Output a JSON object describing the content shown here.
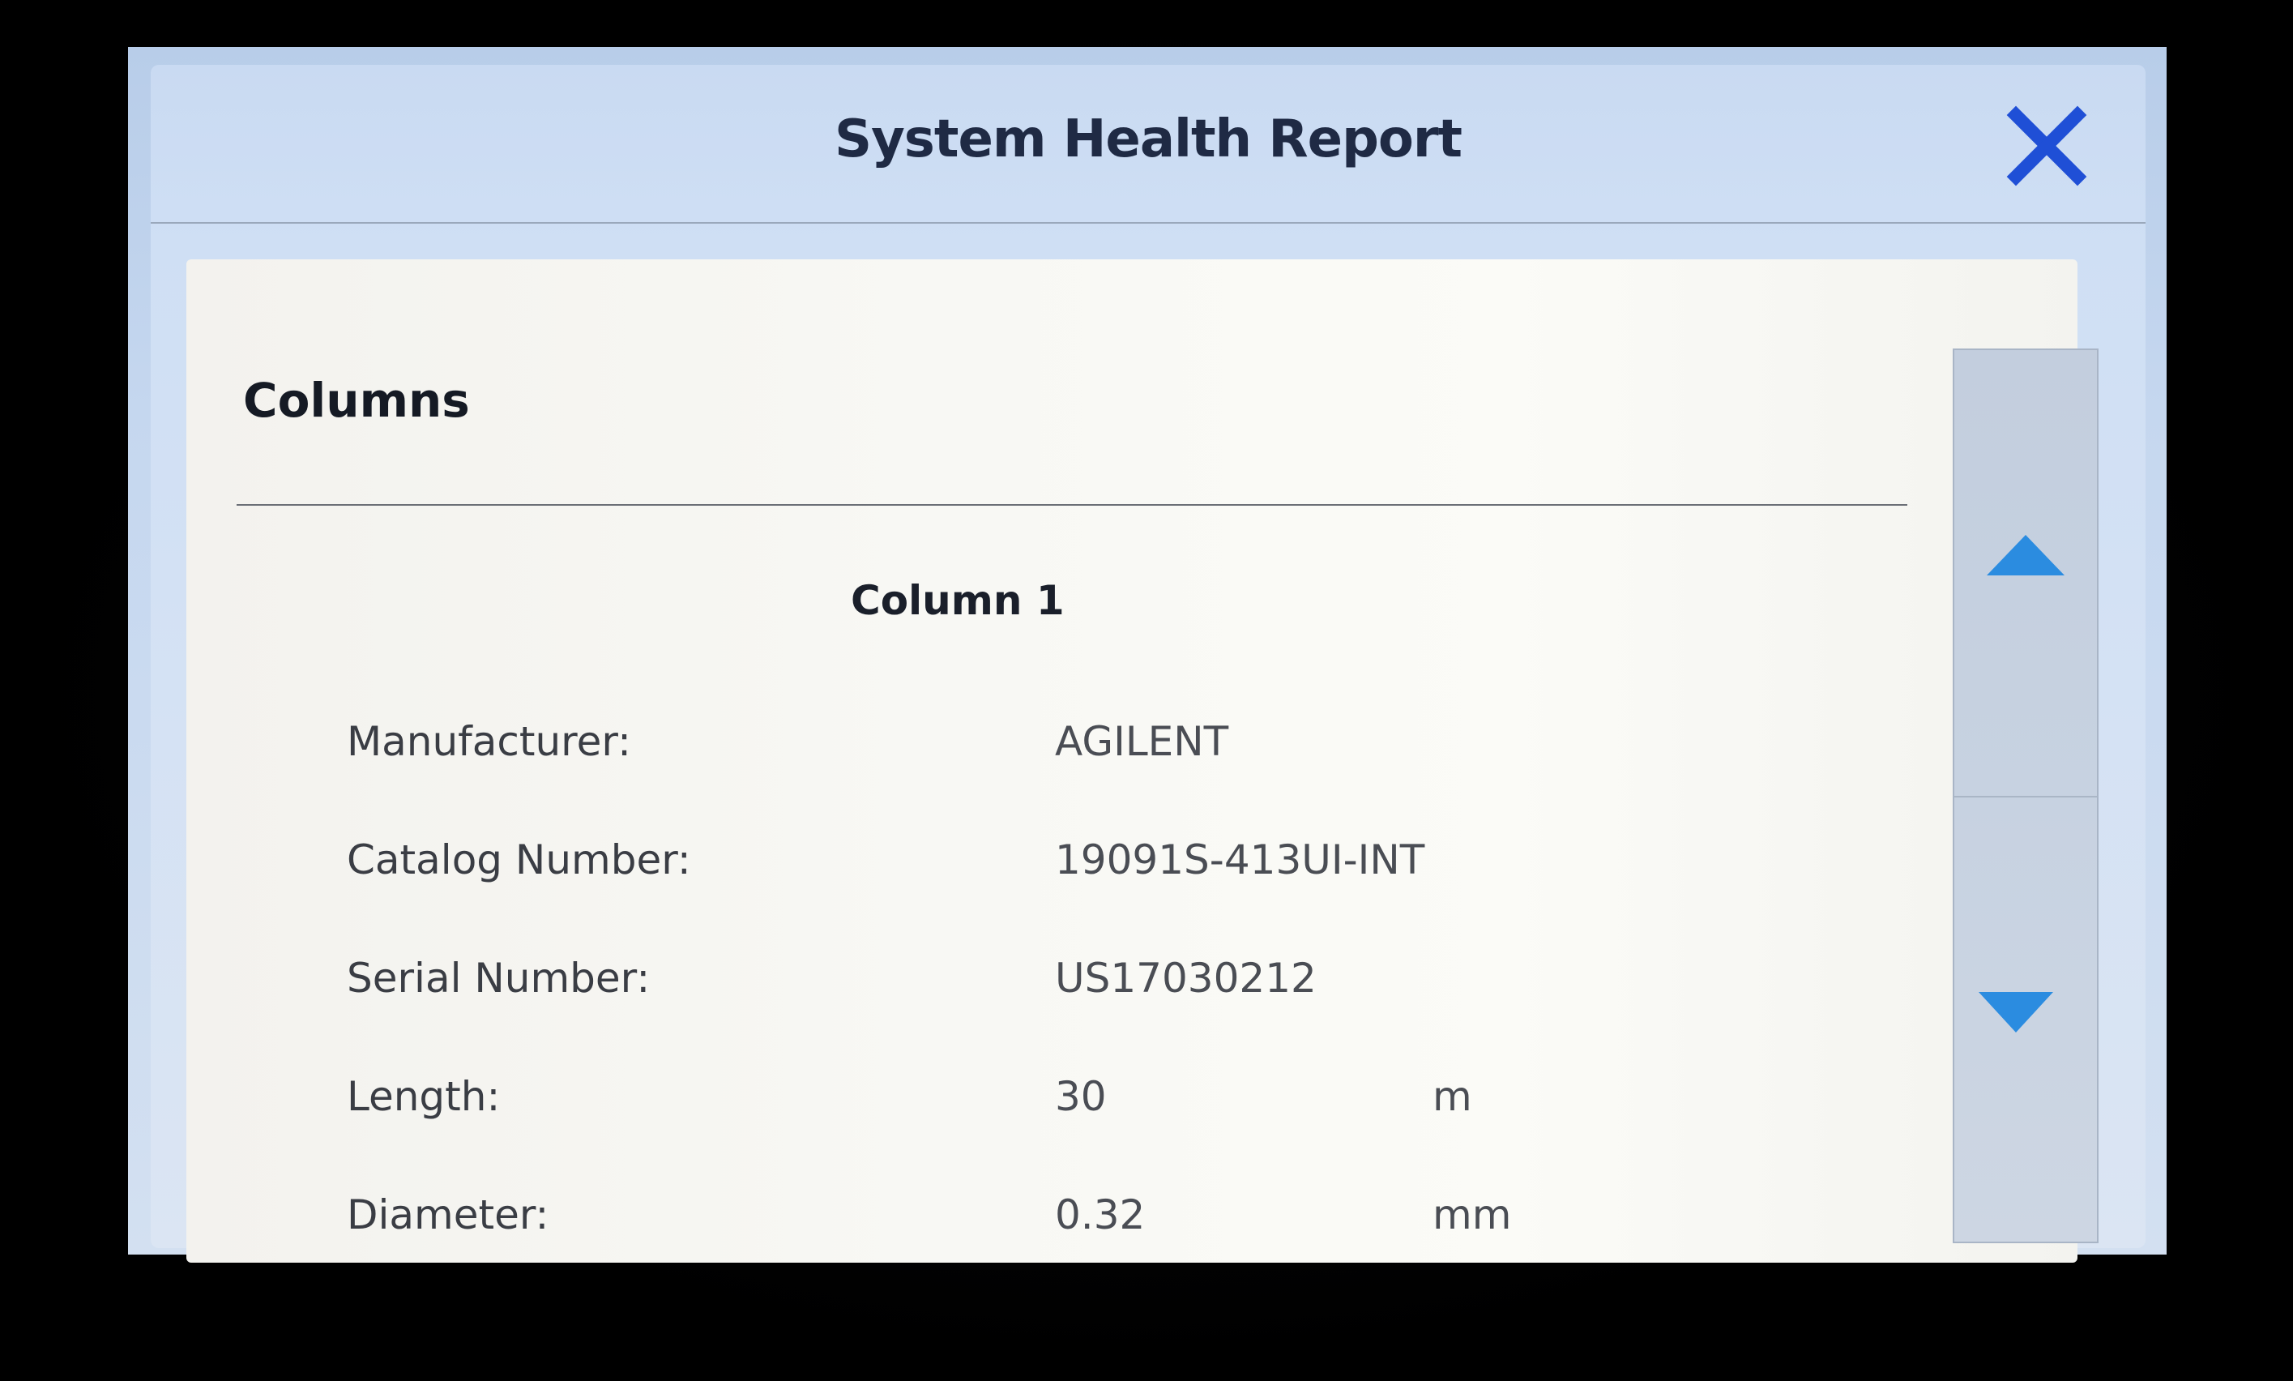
{
  "dialog": {
    "title": "System Health Report",
    "close_icon": "close-icon"
  },
  "section": {
    "title": "Columns"
  },
  "column": {
    "title": "Column 1",
    "fields": [
      {
        "label": "Manufacturer:",
        "value": "AGILENT",
        "unit": ""
      },
      {
        "label": "Catalog Number:",
        "value": "19091S-413UI-INT",
        "unit": ""
      },
      {
        "label": "Serial Number:",
        "value": "US17030212",
        "unit": ""
      },
      {
        "label": "Length:",
        "value": "30",
        "unit": "m"
      },
      {
        "label": "Diameter:",
        "value": "0.32",
        "unit": "mm"
      }
    ]
  },
  "scroll": {
    "up_icon": "triangle-up-icon",
    "down_icon": "triangle-down-icon"
  },
  "colors": {
    "accent_blue": "#1f4fd6",
    "arrow_blue": "#2b8ce0",
    "title_text": "#1f2a44",
    "strip_yellow": "#e7c33a"
  }
}
